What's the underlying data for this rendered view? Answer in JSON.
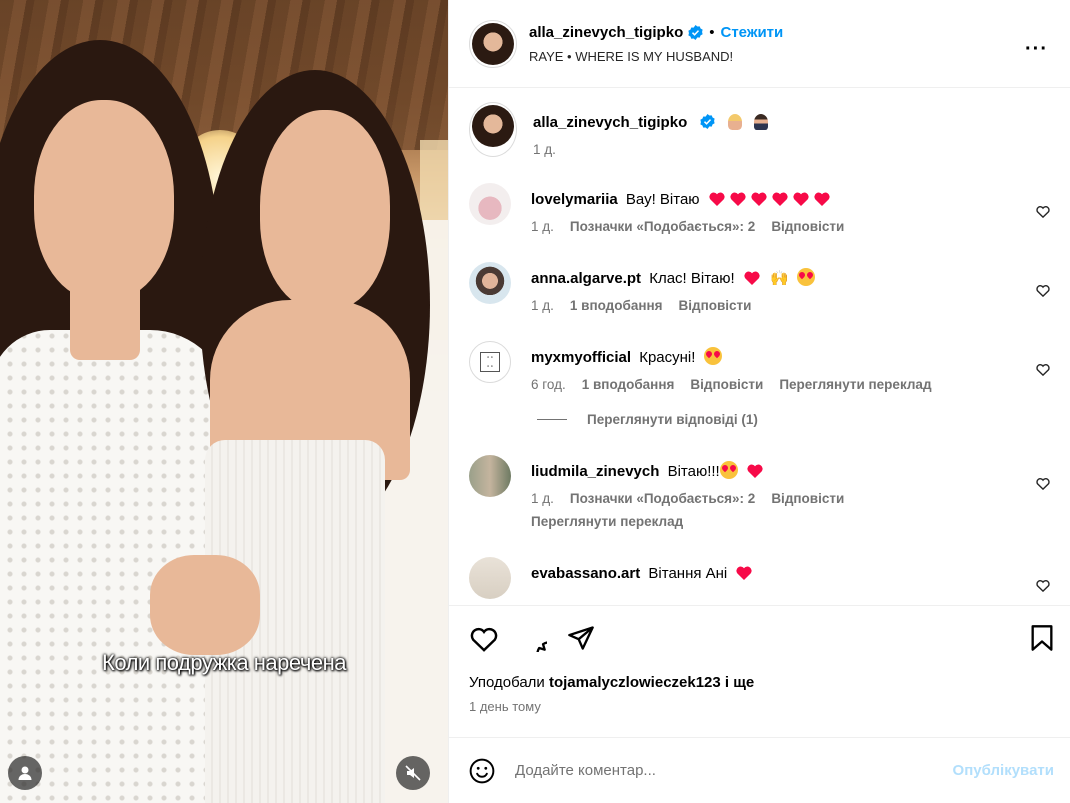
{
  "media": {
    "subtitle": "Коли подружка наречена"
  },
  "header": {
    "username": "alla_zinevych_tigipko",
    "follow_label": "Стежити",
    "separator": "•",
    "audio": "RAYE • WHERE IS MY HUSBAND!"
  },
  "caption": {
    "username": "alla_zinevych_tigipko",
    "time": "1 д."
  },
  "comments": [
    {
      "username": "lovelymariia",
      "text": "Вау! Вітаю",
      "time": "1 д.",
      "likes": "Позначки «Подобається»: 2",
      "reply": "Відповісти"
    },
    {
      "username": "anna.algarve.pt",
      "text": "Клас! Вітаю!",
      "time": "1 д.",
      "likes": "1 вподобання",
      "reply": "Відповісти"
    },
    {
      "username": "myxmyofficial",
      "text": "Красуні!",
      "time": "6 год.",
      "likes": "1 вподобання",
      "reply": "Відповісти",
      "translate": "Переглянути переклад"
    },
    {
      "username": "liudmila_zinevych",
      "text": "Вітаю!!!",
      "time": "1 д.",
      "likes": "Позначки «Подобається»: 2",
      "reply": "Відповісти",
      "translate": "Переглянути переклад"
    },
    {
      "username": "evabassano.art",
      "text": "Вітання Ані"
    }
  ],
  "view_replies": "Переглянути відповіді (1)",
  "likes": {
    "prefix": "Уподобали",
    "user": "tojamalyczlowieczek123",
    "suffix": "і ще"
  },
  "post_time": "1 день тому",
  "composer": {
    "placeholder": "Додайте коментар...",
    "post_label": "Опублікувати"
  },
  "colors": {
    "accent": "#0095f6",
    "verified": "#0095f6",
    "emoji_heart": "#f70a48",
    "muted": "#737373"
  }
}
